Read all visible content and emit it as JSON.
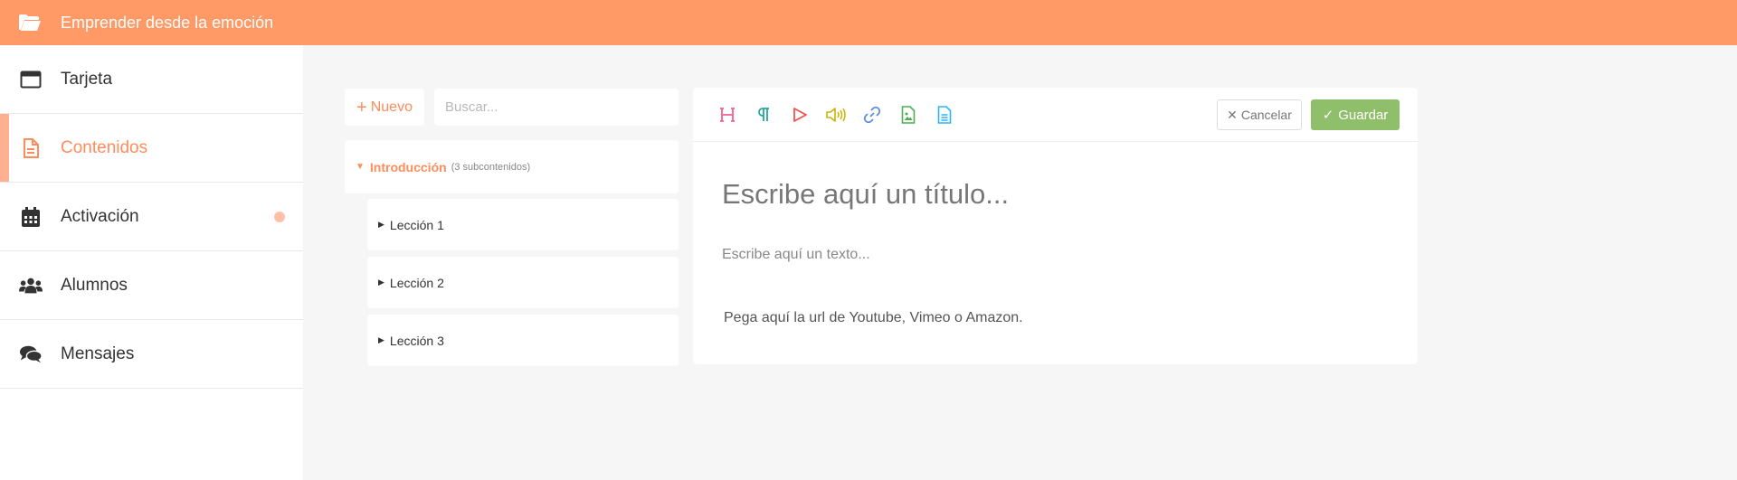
{
  "header": {
    "title": "Emprender desde la emoción",
    "icon": "folder-open-icon"
  },
  "sidebar": {
    "items": [
      {
        "label": "Tarjeta",
        "icon": "window-icon"
      },
      {
        "label": "Contenidos",
        "icon": "document-icon",
        "active": true
      },
      {
        "label": "Activación",
        "icon": "calendar-icon",
        "badge": "dot"
      },
      {
        "label": "Alumnos",
        "icon": "users-icon"
      },
      {
        "label": "Mensajes",
        "icon": "chat-icon"
      }
    ]
  },
  "contents": {
    "new_label": "Nuevo",
    "search_placeholder": "Buscar...",
    "root": {
      "name": "Introducción",
      "count": "(3 subcontenidos)"
    },
    "lessons": [
      "Lección 1",
      "Lección 2",
      "Lección 3"
    ]
  },
  "editor": {
    "tools": [
      "heading-icon",
      "paragraph-icon",
      "play-icon",
      "audio-icon",
      "link-icon",
      "image-file-icon",
      "text-file-icon"
    ],
    "cancel_label": "Cancelar",
    "save_label": "Guardar",
    "title_placeholder": "Escribe aquí un título...",
    "text_placeholder": "Escribe aquí un texto...",
    "url_placeholder": "Pega aquí la url de Youtube, Vimeo o Amazon."
  },
  "colors": {
    "accent": "#ff9966",
    "accent_text": "#ff8c5a",
    "save": "#8fbf6b"
  }
}
